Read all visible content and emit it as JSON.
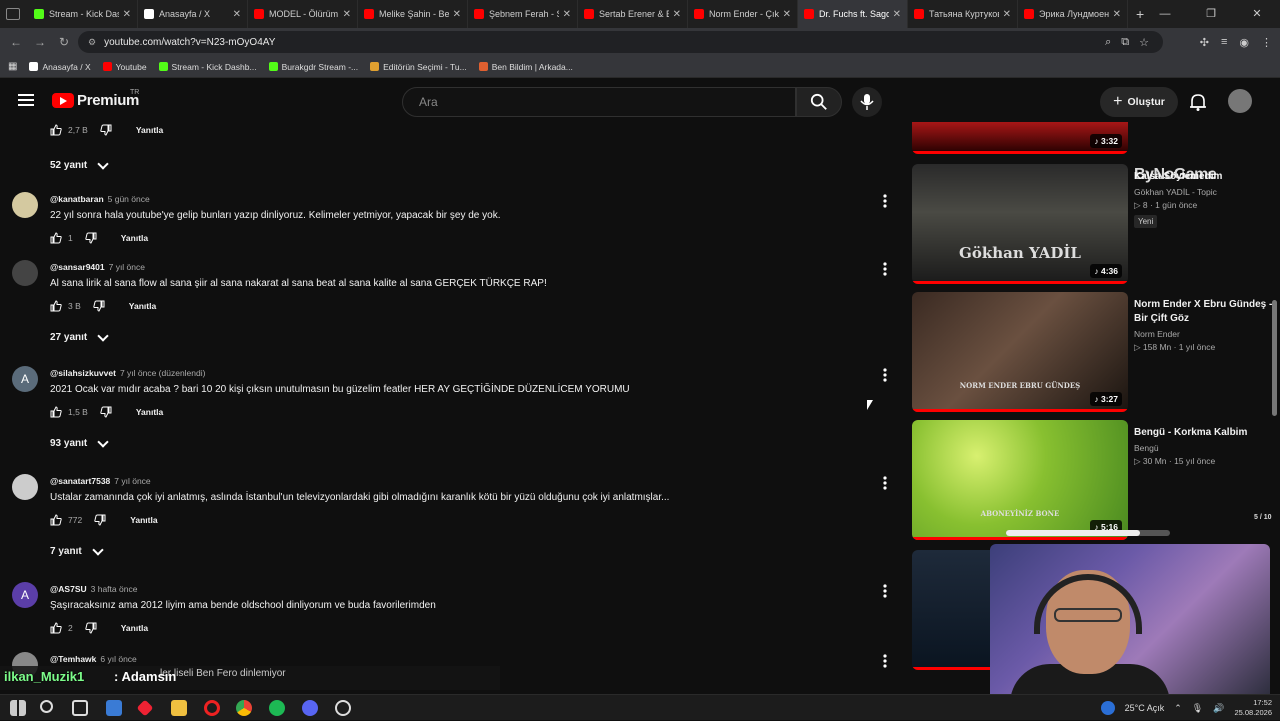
{
  "browser": {
    "tabs": [
      {
        "title": "Stream - Kick Dashb",
        "color": "#53fc18"
      },
      {
        "title": "Anasayfa / X",
        "color": "#ffffff"
      },
      {
        "title": "MODEL - Ölürüm",
        "color": "#ff0000"
      },
      {
        "title": "Melike Şahin - Be",
        "color": "#ff0000"
      },
      {
        "title": "Şebnem Ferah - S",
        "color": "#ff0000"
      },
      {
        "title": "Sertab Erener & B",
        "color": "#ff0000"
      },
      {
        "title": "Norm Ender - Çık",
        "color": "#ff0000"
      },
      {
        "title": "Dr. Fuchs ft. Sago",
        "color": "#ff0000",
        "active": true
      },
      {
        "title": "Татьяна Куртукова",
        "color": "#ff0000"
      },
      {
        "title": "Эрика Лундмоен",
        "color": "#ff0000"
      }
    ],
    "url": "youtube.com/watch?v=N23-mOyO4AY",
    "bookmarks": [
      {
        "label": "Anasayfa / X",
        "color": "#ffffff"
      },
      {
        "label": "Youtube",
        "color": "#ff0000"
      },
      {
        "label": "Stream - Kick Dashb...",
        "color": "#53fc18"
      },
      {
        "label": "Burakgdr Stream -...",
        "color": "#53fc18"
      },
      {
        "label": "Editörün Seçimi - Tu...",
        "color": "#e0a030"
      },
      {
        "label": "Ben Bildim | Arkada...",
        "color": "#e06030"
      }
    ]
  },
  "youtube": {
    "logo_text": "Premium",
    "region": "TR",
    "search_placeholder": "Ara",
    "create_label": "Oluştur"
  },
  "comments": [
    {
      "type": "actions_only",
      "likes": "2,7 B",
      "reply_label": "Yanıtla"
    },
    {
      "type": "replies",
      "label": "52 yanıt"
    },
    {
      "type": "comment",
      "author": "@kanatbaran",
      "time": "5 gün önce",
      "text": "22 yıl sonra hala youtube'ye gelip bunları yazıp dinliyoruz. Kelimeler yetmiyor, yapacak bir şey de yok.",
      "likes": "1",
      "reply_label": "Yanıtla",
      "avatar": "#d4c9a0"
    },
    {
      "type": "comment",
      "author": "@sansar9401",
      "time": "7 yıl önce",
      "text": "Al sana lirik al sana flow al sana şiir al sana nakarat al sana beat al sana kalite al sana GERÇEK TÜRKÇE RAP!",
      "likes": "3 B",
      "reply_label": "Yanıtla",
      "avatar": "#444444"
    },
    {
      "type": "replies",
      "label": "27 yanıt"
    },
    {
      "type": "comment",
      "author": "@silahsizkuvvet",
      "time": "7 yıl önce (düzenlendi)",
      "text": "2021 Ocak var mıdır acaba ? bari 10 20 kişi çıksın unutulmasın bu güzelim featler   HER AY GEÇTİĞİNDE DÜZENLİCEM YORUMU",
      "likes": "1,5 B",
      "reply_label": "Yanıtla",
      "avatar": "#5a6b7a",
      "initial": "A"
    },
    {
      "type": "replies",
      "label": "93 yanıt"
    },
    {
      "type": "comment",
      "author": "@sanatart7538",
      "time": "7 yıl önce",
      "text": "Ustalar zamanında çok iyi anlatmış, aslında İstanbul'un televizyonlardaki gibi olmadığını karanlık kötü bir yüzü olduğunu çok iyi anlatmışlar...",
      "likes": "772",
      "reply_label": "Yanıtla",
      "avatar": "#cccccc"
    },
    {
      "type": "replies",
      "label": "7 yanıt"
    },
    {
      "type": "comment",
      "author": "@AS7SU",
      "time": "3 hafta önce",
      "text": "Şaşıracaksınız ama 2012 liyim ama bende oldschool dinliyorum ve buda favorilerimden",
      "likes": "2",
      "reply_label": "Yanıtla",
      "avatar": "#5b3ea8",
      "initial": "A"
    },
    {
      "type": "comment_partial",
      "author": "@Temhawk",
      "time": "6 yıl önce",
      "avatar": "#888888"
    }
  ],
  "sidebar": [
    {
      "title": "",
      "channel": "",
      "stats": "",
      "duration": "3:32",
      "partial": true
    },
    {
      "title": "Kalsa Söylemedim",
      "channel": "Gökhan YADİL - Topic",
      "stats": "8 · 1 gün önce",
      "duration": "4:36",
      "badge": "Yeni",
      "thumb_text": "Gökhan YADİL"
    },
    {
      "title": "Norm Ender X Ebru Gündeş - Bir Çift Göz",
      "channel": "Norm Ender",
      "stats": "158 Mn · 1 yıl önce",
      "duration": "3:27",
      "thumb_text": "NORM ENDER   EBRU GÜNDEŞ"
    },
    {
      "title": "Bengü - Korkma Kalbim",
      "channel": "Bengü",
      "stats": "30 Mn · 15 yıl önce",
      "duration": "5:16",
      "thumb_text": "ABONEYİNİZ BONE"
    },
    {
      "title": "",
      "channel": "",
      "stats": "",
      "duration": "",
      "partial": true
    }
  ],
  "overlay": {
    "chat_user": "ilkan_Muzik1",
    "chat_message": ": Adamsın",
    "chat_underlay": "ler liseli Ben Fero dinlemiyor",
    "watermark": "ByNoGame",
    "pager": "5 / 10",
    "progress_fraction": 0.82
  },
  "taskbar": {
    "weather": "25°C  Açık",
    "time": "17:52",
    "date": "25.08.2026"
  }
}
